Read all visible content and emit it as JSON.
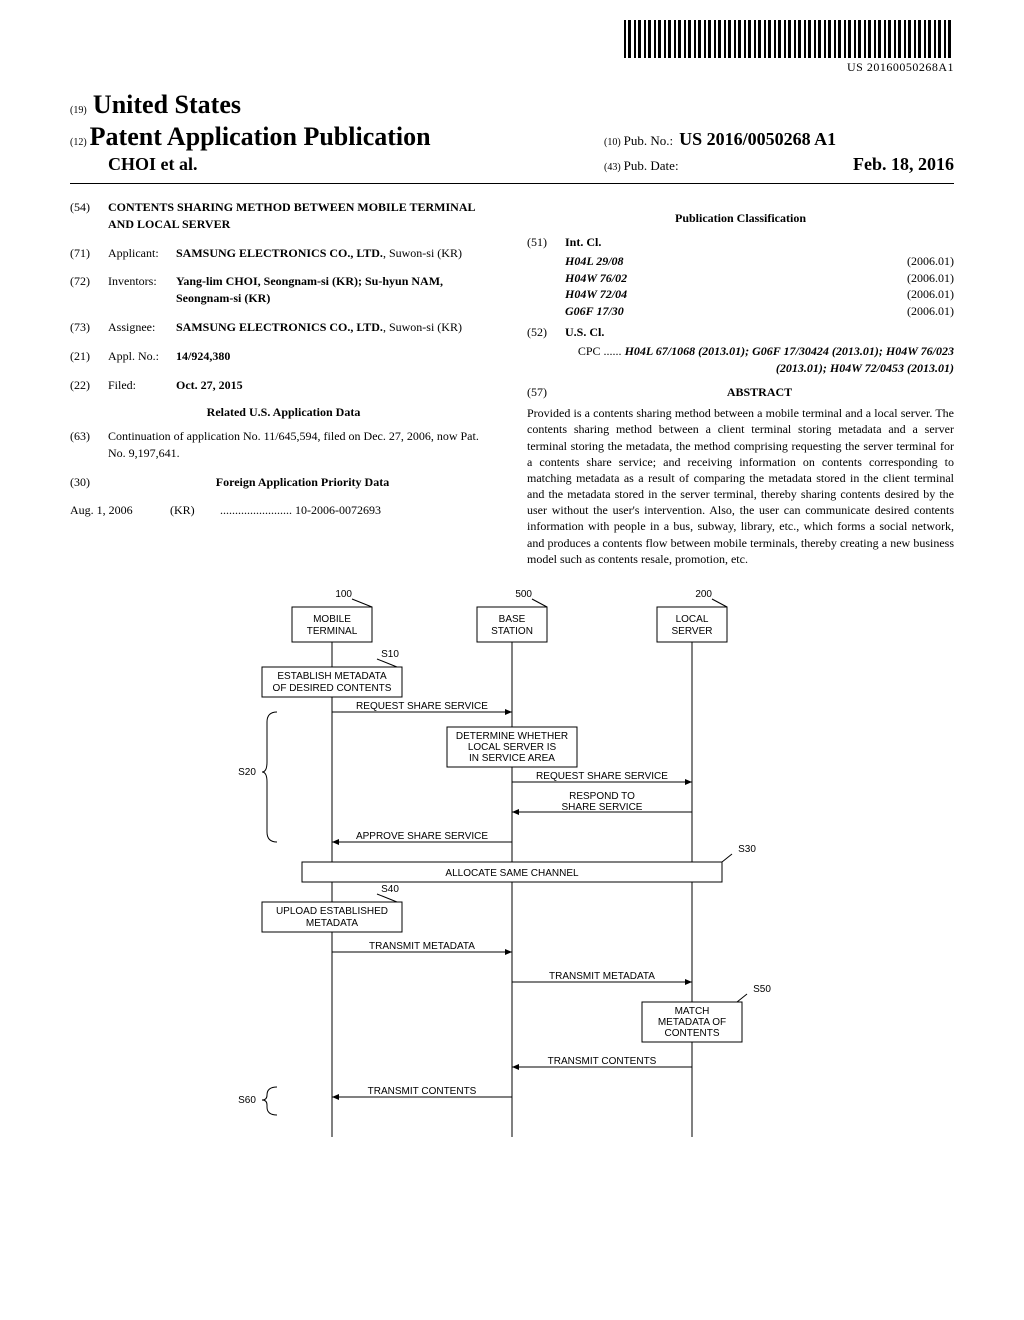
{
  "barcode_text": "US 20160050268A1",
  "country_prefix": "(19)",
  "country": "United States",
  "pub_type_prefix": "(12)",
  "pub_type": "Patent Application Publication",
  "authors": "CHOI et al.",
  "pub_no_prefix": "(10)",
  "pub_no_label": "Pub. No.:",
  "pub_no": "US 2016/0050268 A1",
  "pub_date_prefix": "(43)",
  "pub_date_label": "Pub. Date:",
  "pub_date": "Feb. 18, 2016",
  "left": {
    "title_num": "(54)",
    "title": "CONTENTS SHARING METHOD BETWEEN MOBILE TERMINAL AND LOCAL SERVER",
    "applicant_num": "(71)",
    "applicant_label": "Applicant:",
    "applicant": "SAMSUNG ELECTRONICS CO., LTD.",
    "applicant_loc": ", Suwon-si (KR)",
    "inventors_num": "(72)",
    "inventors_label": "Inventors:",
    "inventors": "Yang-lim CHOI, Seongnam-si (KR); Su-hyun NAM, Seongnam-si (KR)",
    "assignee_num": "(73)",
    "assignee_label": "Assignee:",
    "assignee": "SAMSUNG ELECTRONICS CO., LTD.",
    "assignee_loc": ", Suwon-si (KR)",
    "appl_num": "(21)",
    "appl_label": "Appl. No.:",
    "appl_val": "14/924,380",
    "filed_num": "(22)",
    "filed_label": "Filed:",
    "filed_val": "Oct. 27, 2015",
    "related_heading": "Related U.S. Application Data",
    "related_num": "(63)",
    "related_text": "Continuation of application No. 11/645,594, filed on Dec. 27, 2006, now Pat. No. 9,197,641.",
    "foreign_num": "(30)",
    "foreign_heading": "Foreign Application Priority Data",
    "foreign_date": "Aug. 1, 2006",
    "foreign_country": "(KR)",
    "foreign_app": "10-2006-0072693"
  },
  "right": {
    "class_heading": "Publication Classification",
    "intcl_num": "(51)",
    "intcl_label": "Int. Cl.",
    "intcl": [
      {
        "code": "H04L 29/08",
        "date": "(2006.01)"
      },
      {
        "code": "H04W 76/02",
        "date": "(2006.01)"
      },
      {
        "code": "H04W 72/04",
        "date": "(2006.01)"
      },
      {
        "code": "G06F 17/30",
        "date": "(2006.01)"
      }
    ],
    "uscl_num": "(52)",
    "uscl_label": "U.S. Cl.",
    "cpc_prefix": "CPC ......",
    "cpc": "H04L 67/1068 (2013.01); G06F 17/30424 (2013.01); H04W 76/023 (2013.01); H04W 72/0453 (2013.01)",
    "abstract_num": "(57)",
    "abstract_label": "ABSTRACT",
    "abstract": "Provided is a contents sharing method between a mobile terminal and a local server. The contents sharing method between a client terminal storing metadata and a server terminal storing the metadata, the method comprising requesting the server terminal for a contents share service; and receiving information on contents corresponding to matching metadata as a result of comparing the metadata stored in the client terminal and the metadata stored in the server terminal, thereby sharing contents desired by the user without the user's intervention. Also, the user can communicate desired contents information with people in a bus, subway, library, etc., which forms a social network, and produces a contents flow between mobile terminals, thereby creating a new business model such as contents resale, promotion, etc."
  },
  "diagram": {
    "nodes": {
      "mobile": {
        "ref": "100",
        "label1": "MOBILE",
        "label2": "TERMINAL"
      },
      "base": {
        "ref": "500",
        "label1": "BASE",
        "label2": "STATION"
      },
      "local": {
        "ref": "200",
        "label1": "LOCAL",
        "label2": "SERVER"
      }
    },
    "steps": {
      "s10": "S10",
      "s10_text1": "ESTABLISH METADATA",
      "s10_text2": "OF DESIRED CONTENTS",
      "req_share_1": "REQUEST SHARE SERVICE",
      "s20": "S20",
      "det1": "DETERMINE WHETHER",
      "det2": "LOCAL SERVER IS",
      "det3": "IN SERVICE AREA",
      "req_share_2": "REQUEST SHARE SERVICE",
      "respond1": "RESPOND TO",
      "respond2": "SHARE SERVICE",
      "approve": "APPROVE SHARE SERVICE",
      "s30": "S30",
      "allocate": "ALLOCATE SAME CHANNEL",
      "s40": "S40",
      "upload1": "UPLOAD ESTABLISHED",
      "upload2": "METADATA",
      "transmit_meta_1": "TRANSMIT METADATA",
      "transmit_meta_2": "TRANSMIT METADATA",
      "s50": "S50",
      "match1": "MATCH",
      "match2": "METADATA OF",
      "match3": "CONTENTS",
      "transmit_contents_1": "TRANSMIT CONTENTS",
      "transmit_contents_2": "TRANSMIT CONTENTS",
      "s60": "S60"
    }
  }
}
